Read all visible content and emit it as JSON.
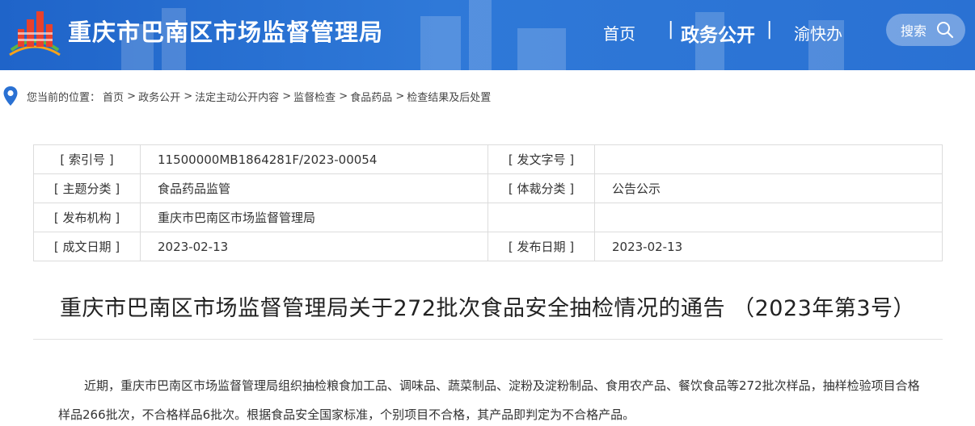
{
  "header": {
    "site_title": "重庆市巴南区市场监督管理局",
    "nav": [
      "首页",
      "政务公开",
      "渝快办"
    ],
    "search_label": "搜索",
    "colors": {
      "header_bg": "#2a71d3",
      "logo_red": "#e8412c",
      "logo_orange": "#f6a21a",
      "logo_green": "#5db443"
    }
  },
  "breadcrumb": {
    "prefix": "您当前的位置：",
    "items": [
      "首页",
      "政务公开",
      "法定主动公开内容",
      "监督检查",
      "食品药品",
      "检查结果及后处置"
    ]
  },
  "meta": {
    "rows": [
      {
        "label1": "[ 索引号 ]",
        "value1": "11500000MB1864281F/2023-00054",
        "label2": "[ 发文字号 ]",
        "value2": ""
      },
      {
        "label1": "[ 主题分类 ]",
        "value1": "食品药品监管",
        "label2": "[ 体裁分类 ]",
        "value2": "公告公示"
      },
      {
        "label1": "[ 发布机构 ]",
        "value1": "重庆市巴南区市场监督管理局",
        "label2": "",
        "value2": ""
      },
      {
        "label1": "[ 成文日期 ]",
        "value1": "2023-02-13",
        "label2": "[ 发布日期 ]",
        "value2": "2023-02-13"
      }
    ]
  },
  "article": {
    "title": "重庆市巴南区市场监督管理局关于272批次食品安全抽检情况的通告 （2023年第3号）",
    "paragraph": "近期，重庆市巴南区市场监督管理局组织抽检粮食加工品、调味品、蔬菜制品、淀粉及淀粉制品、食用农产品、餐饮食品等272批次样品，抽样检验项目合格样品266批次，不合格样品6批次。根据食品安全国家标准，个别项目不合格，其产品即判定为不合格产品。"
  }
}
